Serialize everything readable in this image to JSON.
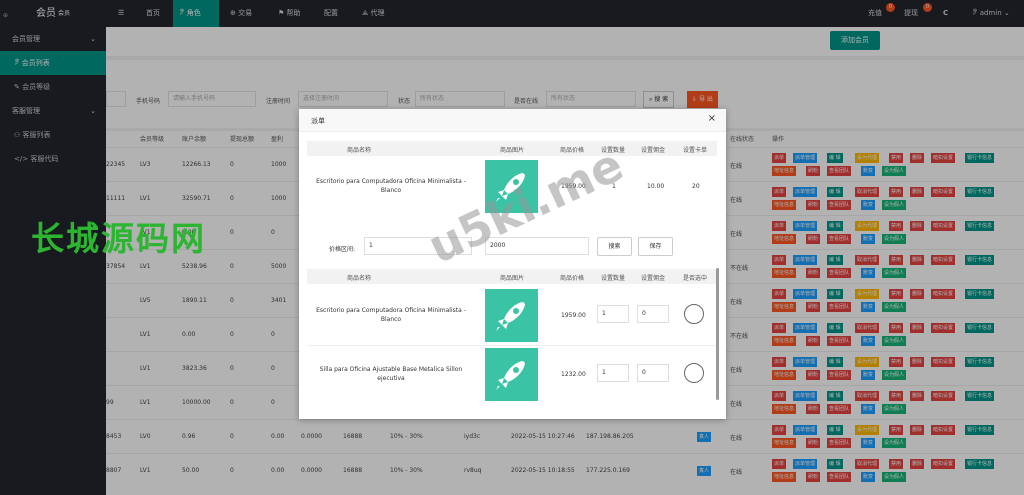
{
  "app": {
    "logo": "会员",
    "logo_sub": "会员",
    "corner": "⊕"
  },
  "topnav": {
    "items": [
      {
        "icon": "☰",
        "label": ""
      },
      {
        "label": "首页"
      },
      {
        "icon": "ꐕ",
        "label": "角色"
      },
      {
        "icon": "⊕",
        "label": "交易"
      },
      {
        "icon": "⚑",
        "label": "帮助"
      },
      {
        "label": "配置"
      },
      {
        "icon": "⟁",
        "label": "代理"
      }
    ],
    "recharge": "充值",
    "recharge_badge": "0",
    "withdraw": "提现",
    "withdraw_badge": "0",
    "refresh": "C",
    "user": "admin"
  },
  "sidebar": {
    "items": [
      {
        "label": "会员管理",
        "group": true
      },
      {
        "label": "会员列表",
        "active": true
      },
      {
        "label": "会员等级"
      },
      {
        "label": "客服管理",
        "group": true
      },
      {
        "label": "客服列表"
      },
      {
        "label": "客服代码"
      }
    ]
  },
  "toolbar": {
    "add_label": "添加会员"
  },
  "filters": {
    "phone_label": "手机号码",
    "phone_placeholder": "请输入手机号码",
    "regtime_label": "注册时间",
    "regtime_placeholder": "选择注册时间",
    "status_label": "状态",
    "status_value": "所有状态",
    "online_label": "是否在线",
    "online_value": "所有状态",
    "search_label": "搜 索",
    "export_label": "导 出"
  },
  "table": {
    "headers": [
      "会员等级",
      "账户余额",
      "提现总额",
      "盈利",
      "在线状态",
      "操作"
    ],
    "rows": [
      {
        "id": "22345",
        "level": "LV3",
        "balance": "12266.13",
        "withdraw": "0",
        "profit": "1000",
        "status": "在线"
      },
      {
        "id": "11111",
        "level": "LV1",
        "balance": "32590.71",
        "withdraw": "0",
        "profit": "1000",
        "status": "在线"
      },
      {
        "id": "",
        "level": "LV1",
        "balance": "0.00",
        "withdraw": "0",
        "profit": "0",
        "status": "在线"
      },
      {
        "id": "37854",
        "level": "LV1",
        "balance": "5238.96",
        "withdraw": "0",
        "profit": "5000",
        "status": "不在线"
      },
      {
        "id": "",
        "level": "LV5",
        "balance": "1890.11",
        "withdraw": "0",
        "profit": "3401",
        "status": "在线"
      },
      {
        "id": "",
        "level": "LV1",
        "balance": "0.00",
        "withdraw": "0",
        "profit": "0",
        "status": "不在线"
      },
      {
        "id": "",
        "level": "LV1",
        "balance": "3823.36",
        "withdraw": "0",
        "profit": "0",
        "status": "在线"
      },
      {
        "id": "99",
        "level": "LV1",
        "balance": "10000.00",
        "withdraw": "0",
        "profit": "0",
        "status": "在线"
      },
      {
        "id": "8453",
        "level": "LV0",
        "balance": "0.96",
        "withdraw": "0",
        "profit": "0.00",
        "extra1": "0.0000",
        "extra2": "16888",
        "rate": "10% - 30%",
        "user": "iyd3c",
        "time": "2022-05-15 10:27:46",
        "ip": "187.198.86.205",
        "tag": "真人",
        "status": "在线"
      },
      {
        "id": "8807",
        "level": "LV1",
        "balance": "50.00",
        "withdraw": "0",
        "profit": "0.00",
        "extra1": "0.0000",
        "extra2": "16888",
        "rate": "10% - 30%",
        "user": "rv8uq",
        "time": "2022-05-15 10:18:55",
        "ip": "177.225.0.169",
        "tag": "真人",
        "status": "在线"
      }
    ],
    "actions": {
      "dispatch": "派单",
      "dispatch_manage": "派单管理",
      "edit": "编 辑",
      "set_agent": "设为代理",
      "cancel_agent": "取消代理",
      "disable": "禁用",
      "delete": "删除",
      "deduct": "暗扣设置",
      "bank": "银行卡信息",
      "address": "地址信息",
      "brush": "刷粉",
      "team": "查看团队",
      "account": "账变",
      "fake": "设为假人"
    }
  },
  "modal": {
    "title": "派单",
    "table1_headers": [
      "商品名称",
      "商品图片",
      "商品价格",
      "设置数量",
      "设置佣金",
      "设置卡单"
    ],
    "table1_row": {
      "name": "Escritorio para Computadora Oficina Minimalista - Blanco",
      "price": "1959.00",
      "qty": "1",
      "commission": "10.00",
      "card": "20"
    },
    "range_label": "价格区间:",
    "range_min": "1",
    "range_max": "2000",
    "search_btn": "搜索",
    "save_btn": "保存",
    "table2_headers": [
      "商品名称",
      "商品图片",
      "商品价格",
      "设置数量",
      "设置佣金",
      "是否选中"
    ],
    "table2_rows": [
      {
        "name": "Escritorio para Computadora Oficina Minimalista - Blanco",
        "price": "1959.00",
        "qty": "1",
        "commission": "0"
      },
      {
        "name": "Silla para Oficina Ajustable Base Metalica Sillon ejecutiva",
        "price": "1232.00",
        "qty": "1",
        "commission": "0"
      }
    ]
  },
  "watermarks": {
    "cn": "长城源码网",
    "url": "u5ki.me"
  },
  "colors": {
    "teal": "#009688",
    "orange": "#ff5722",
    "red": "#e64340",
    "blue": "#1e9fff",
    "yellow": "#ffb800",
    "green": "#16b777"
  }
}
